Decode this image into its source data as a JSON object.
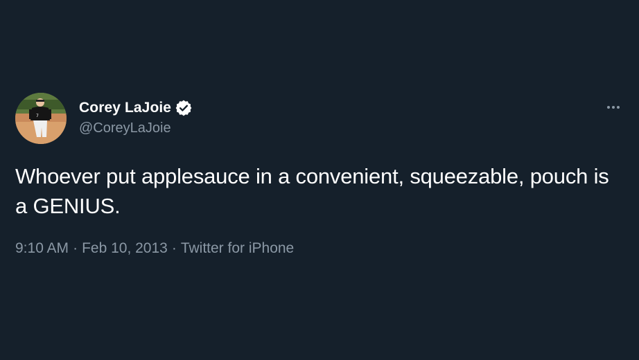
{
  "tweet": {
    "author": {
      "display_name": "Corey LaJoie",
      "handle": "@CoreyLaJoie",
      "verified": true
    },
    "text": "Whoever put applesauce in a convenient, squeezable, pouch is a GENIUS.",
    "time": "9:10 AM",
    "separator": "·",
    "date": "Feb 10, 2013",
    "source": "Twitter for iPhone"
  },
  "colors": {
    "background": "#15202b",
    "text_primary": "#ffffff",
    "text_secondary": "#8b98a5"
  },
  "icons": {
    "verified": "verified-badge-icon",
    "more": "more-options-icon"
  }
}
